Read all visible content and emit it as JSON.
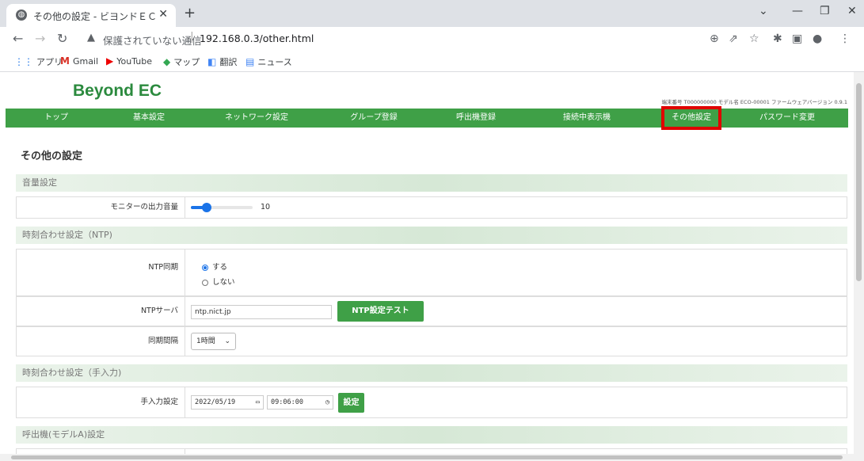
{
  "browser": {
    "tab_title": "その他の設定 - ビヨンドＥＣ",
    "security_label": "保護されていない通信",
    "url": "192.168.0.3/other.html",
    "bookmarks": [
      {
        "label": "アプリ",
        "icon": "apps-icon"
      },
      {
        "label": "Gmail",
        "icon": "gmail-icon"
      },
      {
        "label": "YouTube",
        "icon": "youtube-icon"
      },
      {
        "label": "マップ",
        "icon": "maps-icon"
      },
      {
        "label": "翻訳",
        "icon": "translate-icon"
      },
      {
        "label": "ニュース",
        "icon": "news-icon"
      }
    ]
  },
  "header": {
    "brand": "Beyond EC",
    "device_info": "端末番号 T000000000  モデル名 ECO-00001  ファームウェアバージョン 0.9.1"
  },
  "nav": {
    "items": [
      "トップ",
      "基本設定",
      "ネットワーク設定",
      "グループ登録",
      "呼出機登録",
      "接続中表示機",
      "その他設定",
      "パスワード変更"
    ],
    "active_index": 6,
    "highlight_color": "#e00000"
  },
  "main": {
    "title": "その他の設定",
    "volume_section": {
      "title": "音量設定",
      "monitor_label": "モニターの出力音量",
      "value": "10",
      "level_fraction": 0.25
    },
    "ntp_section": {
      "title": "時刻合わせ設定（NTP)",
      "sync_label": "NTP同期",
      "sync_options": [
        "する",
        "しない"
      ],
      "sync_selected": "する",
      "server_label": "NTPサーバ",
      "server_value": "ntp.nict.jp",
      "test_button": "NTP設定テスト",
      "interval_label": "同期間隔",
      "interval_value": "1時間"
    },
    "manual_section": {
      "title": "時刻合わせ設定（手入力)",
      "label": "手入力設定",
      "date_value": "2022/05/19",
      "time_value": "09:06:00",
      "set_button": "設定"
    },
    "caller_section": {
      "title": "呼出機(モデルA)設定"
    }
  },
  "colors": {
    "nav_green": "#3fa047",
    "brand_green": "#2b8a3e"
  }
}
